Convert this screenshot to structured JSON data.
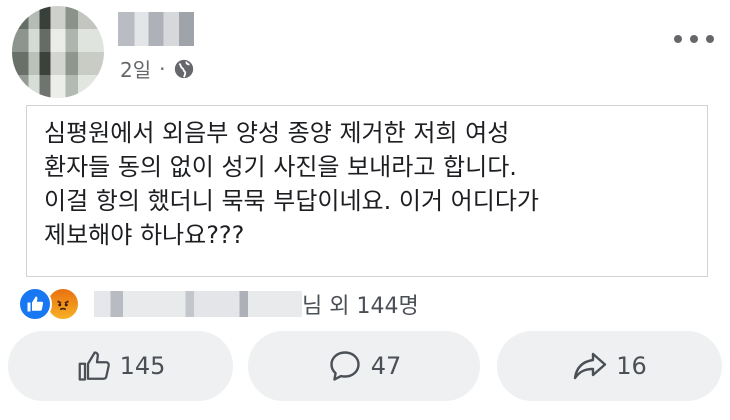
{
  "post": {
    "author_name": "████",
    "timestamp": "2일",
    "separator": "·",
    "privacy_icon": "globe-icon",
    "lines": [
      "심평원에서 외음부 양성 종양 제거한 저희 여성",
      "환자들 동의 없이 성기 사진을 보내라고 합니다.",
      "이걸 항의 했더니 묵묵 부답이네요. 이거 어디다가",
      "제보해야 하나요???"
    ]
  },
  "reactions": {
    "icons": [
      "like-icon",
      "angry-icon"
    ],
    "names_blurred": "████ ████ ███",
    "summary": "님 외 144명"
  },
  "actions": {
    "like_count": "145",
    "comment_count": "47",
    "share_count": "16"
  },
  "colors": {
    "like_blue": "#1877f2",
    "angry_orange": "#f0801a",
    "button_bg": "#eef0f2",
    "muted_text": "#65676b"
  }
}
